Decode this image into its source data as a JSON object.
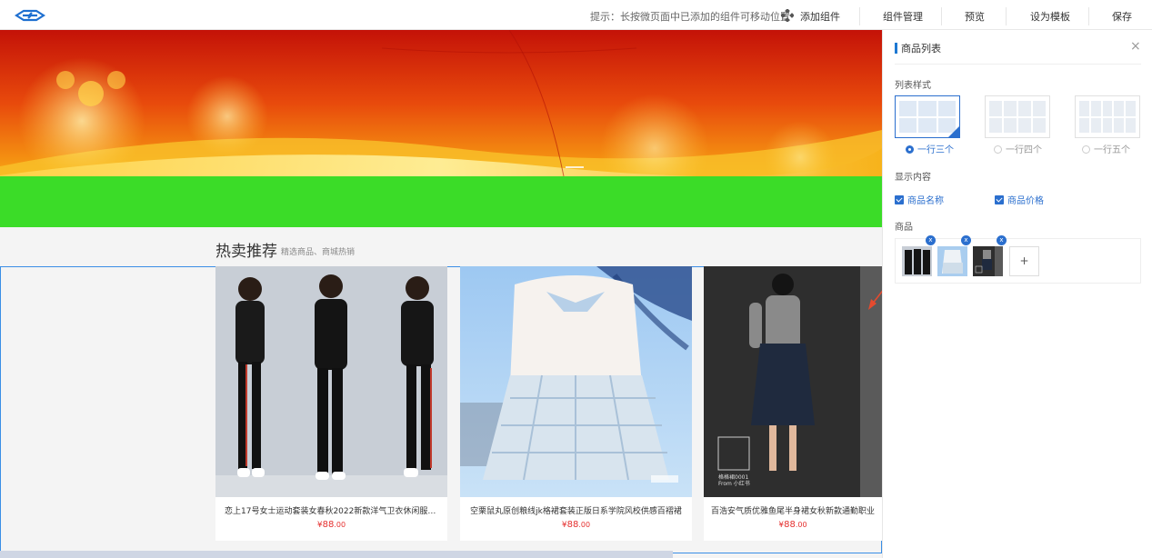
{
  "topbar": {
    "tip": "提示：长按微页面中已添加的组件可移动位置",
    "add_component": "添加组件",
    "manage": "组件管理",
    "preview": "预览",
    "set_template": "设为模板",
    "save": "保存"
  },
  "section": {
    "title": "热卖推荐",
    "subtitle": "精选商品、商城热销"
  },
  "products": [
    {
      "name": "恋上17号女士运动套装女春秋2022新款洋气卫衣休闲服秋...",
      "currency": "¥",
      "price_int": "88",
      "price_dec": ".00"
    },
    {
      "name": "空栗鼠丸原创粮线jk格裙套装正版日系学院风校供感百褶裙",
      "currency": "¥",
      "price_int": "88",
      "price_dec": ".00"
    },
    {
      "name": "百浩安气质优雅鱼尾半身裙女秋新款通勤职业高腰",
      "currency": "¥",
      "price_int": "88",
      "price_dec": ".00"
    }
  ],
  "product3_overlay": {
    "line1": "格格裙0001",
    "line2": "From 小红书"
  },
  "panel": {
    "title": "商品列表",
    "close": "×",
    "list_style_label": "列表样式",
    "style_options": [
      "一行三个",
      "一行四个",
      "一行五个"
    ],
    "selected_style": 0,
    "display_label": "显示内容",
    "show_name": "商品名称",
    "show_price": "商品价格",
    "goods_label": "商品",
    "remove": "x",
    "add": "+"
  },
  "colors": {
    "accent": "#2b6fce",
    "price": "#e5302f",
    "green_bar": "#3bdc28",
    "selection_border": "#3a8ee6"
  }
}
